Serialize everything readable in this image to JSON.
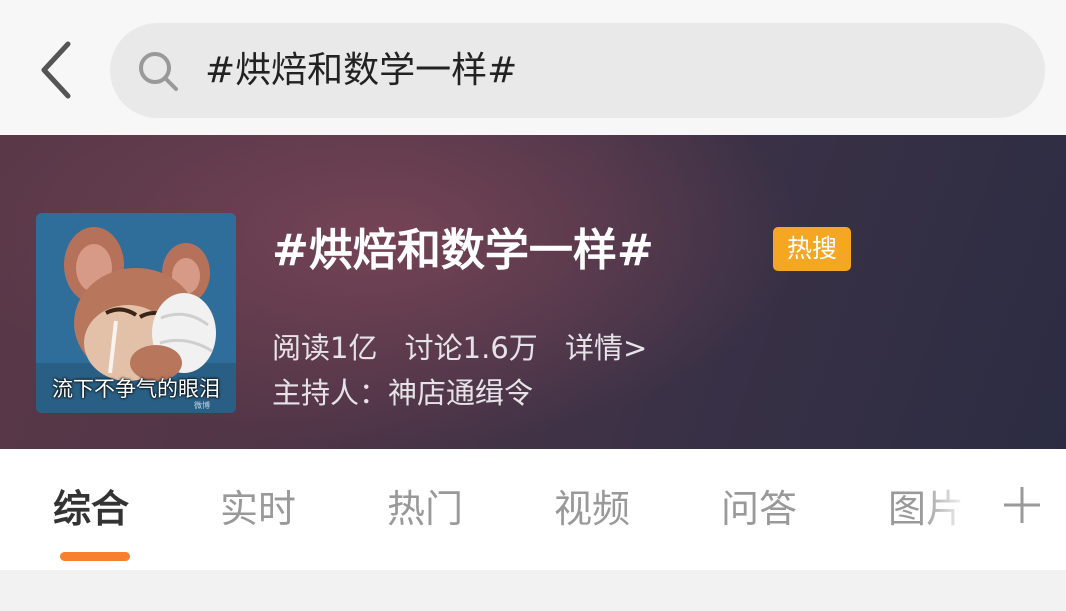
{
  "search": {
    "query": "#烘焙和数学一样#"
  },
  "topic": {
    "title": "#烘焙和数学一样#",
    "badge": "热搜",
    "reads": "阅读1亿",
    "discussions": "讨论1.6万",
    "details_link": "详情>",
    "host": "主持人：神店通缉令",
    "avatar_caption": "流下不争气的眼泪"
  },
  "tabs": [
    {
      "label": "综合",
      "active": true
    },
    {
      "label": "实时",
      "active": false
    },
    {
      "label": "热门",
      "active": false
    },
    {
      "label": "视频",
      "active": false
    },
    {
      "label": "问答",
      "active": false
    },
    {
      "label": "图片",
      "active": false
    }
  ],
  "icons": {
    "back": "back-arrow-icon",
    "search": "search-icon",
    "add_tab": "plus-icon"
  },
  "colors": {
    "badge": "#f5a623",
    "tab_underline": "#f7802f",
    "banner_dark": "#2b2c42",
    "banner_warm": "#764456"
  }
}
